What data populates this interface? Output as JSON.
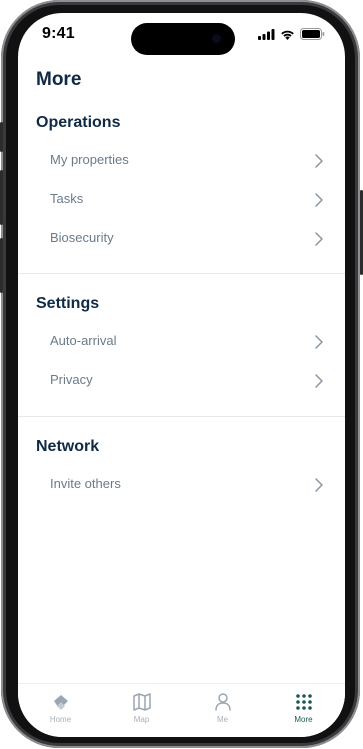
{
  "status_bar": {
    "time": "9:41"
  },
  "page": {
    "title": "More"
  },
  "sections": [
    {
      "title": "Operations",
      "items": [
        {
          "label": "My properties"
        },
        {
          "label": "Tasks"
        },
        {
          "label": "Biosecurity"
        }
      ]
    },
    {
      "title": "Settings",
      "items": [
        {
          "label": "Auto-arrival"
        },
        {
          "label": "Privacy"
        }
      ]
    },
    {
      "title": "Network",
      "items": [
        {
          "label": "Invite others"
        }
      ]
    }
  ],
  "tab_bar": {
    "tabs": [
      {
        "label": "Home",
        "icon": "home-icon",
        "active": false
      },
      {
        "label": "Map",
        "icon": "map-icon",
        "active": false
      },
      {
        "label": "Me",
        "icon": "person-icon",
        "active": false
      },
      {
        "label": "More",
        "icon": "grid-dots-icon",
        "active": true
      }
    ]
  },
  "colors": {
    "heading": "#0f2a44",
    "item_text": "#6b7a8a",
    "active_tab": "#1f5a52",
    "inactive_tab": "#a8b1bb"
  }
}
